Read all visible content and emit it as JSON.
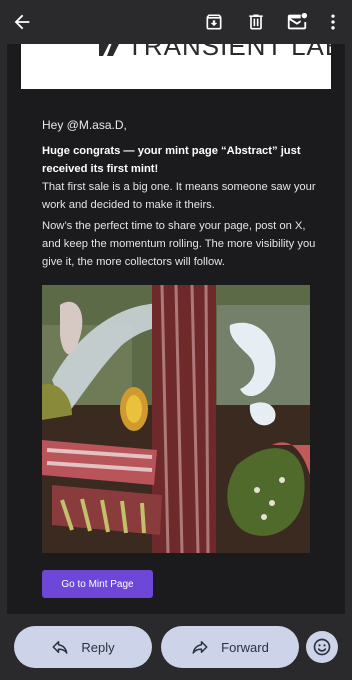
{
  "toolbar": {
    "back_icon": "arrow-left-icon",
    "archive_icon": "archive-icon",
    "delete_icon": "trash-icon",
    "mark_unread_icon": "mail-unread-icon",
    "more_icon": "more-vertical-icon"
  },
  "email": {
    "logo_text": "TRANSIENT LABS",
    "greeting": "Hey @M.asa.D,",
    "headline": "Huge congrats — your mint page “Abstract” just received its first mint!",
    "line1": "That first sale is a big one. It means someone saw your work and decided to make it theirs.",
    "line2": "Now’s the perfect time to share your page, post on X, and keep the momentum rolling. The more visibility you give it, the more collectors will follow.",
    "cta_label": "Go to Mint Page",
    "accent_color": "#6c47d8"
  },
  "actions": {
    "reply_label": "Reply",
    "forward_label": "Forward",
    "emoji_icon": "smiley-icon"
  }
}
